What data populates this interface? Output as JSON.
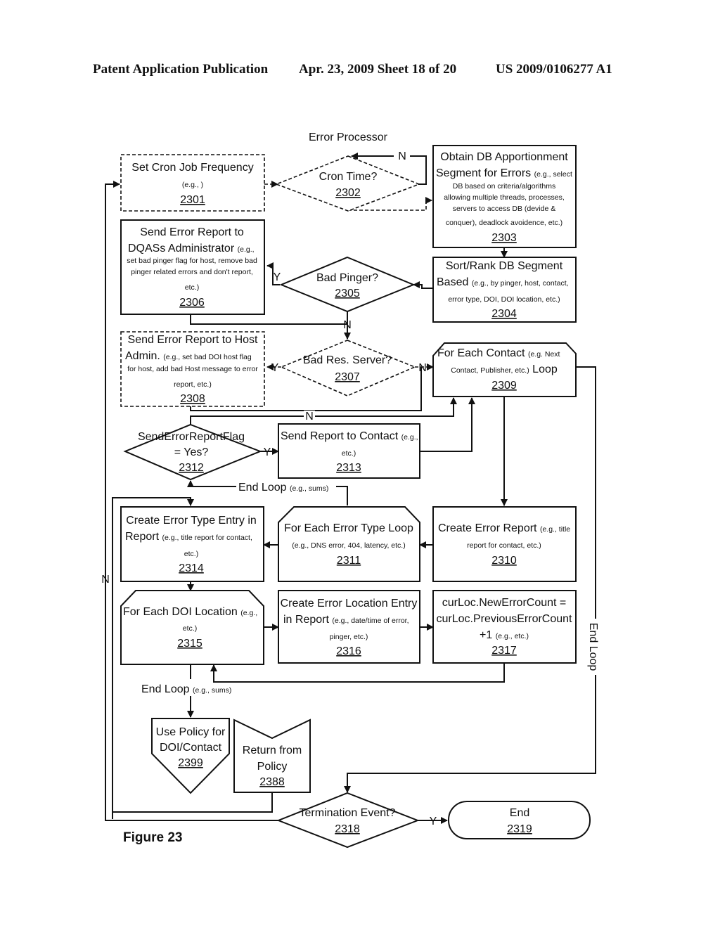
{
  "header": {
    "publication": "Patent Application Publication",
    "date_sheet": "Apr. 23, 2009  Sheet 18 of 20",
    "patent_number": "US 2009/0106277 A1"
  },
  "diagram": {
    "title": "Error Processor",
    "figure_label": "Figure 23",
    "nodes": {
      "n2301": {
        "line1": "Set Cron Job Frequency",
        "detail": "(e.g., )",
        "id": "2301"
      },
      "n2302": {
        "line1": "Cron Time?",
        "id": "2302"
      },
      "n2303": {
        "line1": "Obtain DB Apportionment",
        "line2": "Segment for Errors",
        "line2b": "(e.g., select",
        "d1": "DB based on criteria/algorithms",
        "d2": "allowing multiple threads, processes,",
        "d3": "servers to access DB (devide &",
        "d4": "conquer), deadlock avoidence, etc.)",
        "id": "2303"
      },
      "n2304": {
        "line1": "Sort/Rank DB Segment",
        "line2": "Based",
        "line2b": "(e.g., by pinger, host, contact,",
        "d1": "error type, DOI, DOI location, etc.)",
        "id": "2304"
      },
      "n2305": {
        "line1": "Bad Pinger?",
        "id": "2305"
      },
      "n2306": {
        "line1": "Send Error Report to",
        "line2": "DQASs Administrator",
        "line2b": "(e.g.,",
        "d1": "set bad pinger flag for host, remove bad",
        "d2": "pinger related errors and don't report,",
        "d3": "etc.)",
        "id": "2306"
      },
      "n2307": {
        "line1": "Bad Res. Server?",
        "id": "2307"
      },
      "n2308": {
        "line1": "Send Error Report to Host",
        "line2": "Admin.",
        "line2b": "(e.g.,  set bad DOI host flag",
        "d1": "for host, add bad Host message to error",
        "d2": "report, etc.)",
        "id": "2308"
      },
      "n2309": {
        "line1": "For Each Contact",
        "line1b": "(e.g. Next",
        "d1": "Contact, Publisher, etc.)",
        "line2": "Loop",
        "id": "2309"
      },
      "n2310": {
        "line1": "Create Error Report",
        "line1b": "(e.g., title",
        "d1": "report for contact, etc.)",
        "id": "2310"
      },
      "n2311": {
        "line1": "For Each Error Type Loop",
        "d1": "(e.g., DNS error, 404, latency, etc.)",
        "id": "2311"
      },
      "n2312": {
        "line1": "SendErrorReportFlag",
        "line2": "= Yes?",
        "id": "2312"
      },
      "n2313": {
        "line1": "Send Report to Contact",
        "line1b": "(e.g.,",
        "d1": "etc.)",
        "id": "2313"
      },
      "n2314": {
        "line1": "Create Error Type Entry in",
        "line2": "Report",
        "line2b": "(e.g., title report for contact,",
        "d1": "etc.)",
        "id": "2314"
      },
      "n2315": {
        "line1": "For Each DOI Location",
        "line1b": "(e.g.,",
        "d1": "etc.)",
        "id": "2315"
      },
      "n2316": {
        "line1": "Create Error Location Entry",
        "line2": "in Report",
        "line2b": "(e.g., date/time of error,",
        "d1": "pinger, etc.)",
        "id": "2316"
      },
      "n2317": {
        "line1": "curLoc.NewErrorCount =",
        "line2": "curLoc.PreviousErrorCount",
        "line3": "+1",
        "line3b": "(e.g.,  etc.)",
        "id": "2317"
      },
      "n2318": {
        "line1": "Termination Event?",
        "id": "2318"
      },
      "n2319": {
        "line1": "End",
        "id": "2319"
      },
      "n2399": {
        "line1": "Use Policy for",
        "line2": "DOI/Contact",
        "id": "2399"
      },
      "n2388": {
        "line1": "Return from",
        "line2": "Policy",
        "id": "2388"
      }
    },
    "edge_labels": {
      "yes": "Y",
      "no": "N",
      "end_loop": "End Loop",
      "end_loop_detail": "(e.g., sums)"
    }
  }
}
